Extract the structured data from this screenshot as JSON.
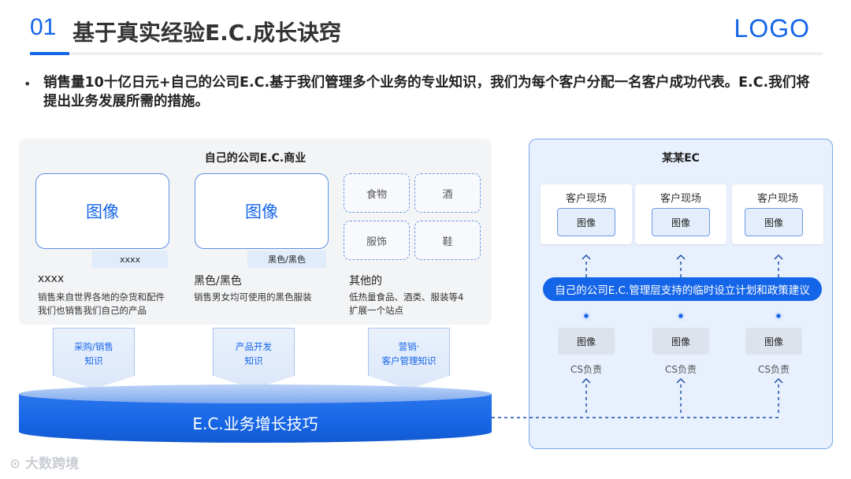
{
  "header": {
    "number": "01",
    "title": "基于真实经验E.C.成长诀窍",
    "logo": "LOGO"
  },
  "bullet": {
    "text": "销售量10十亿日元+自己的公司E.C.基于我们管理多个业务的专业知识，我们为每个客户分配一名客户成功代表。E.C.我们将提出业务发展所需的措施。"
  },
  "left_panel": {
    "title": "自己的公司E.C.商业",
    "columns": [
      {
        "image_label": "图像",
        "tag": "xxxx",
        "heading": "xxxx",
        "desc_lines": [
          "销售来自世界各地的杂货和配件",
          "我们也销售我们自己的产品"
        ]
      },
      {
        "image_label": "图像",
        "tag": "黑色/黑色",
        "heading": "黑色/黑色",
        "desc_lines": [
          "销售男女均可使用的黑色服装",
          ""
        ]
      },
      {
        "heading": "其他的",
        "desc_lines": [
          "低热量食品、酒类、服装等4",
          "扩展一个站点"
        ]
      }
    ],
    "categories": [
      "食物",
      "酒",
      "服饰",
      "鞋"
    ]
  },
  "knowledge": [
    {
      "line1": "采购/销售",
      "line2": "知识"
    },
    {
      "line1": "产品开发",
      "line2": "知识"
    },
    {
      "line1": "营销·",
      "line2": "客户管理知识"
    }
  ],
  "cylinder": {
    "label": "E.C.业务增长技巧"
  },
  "right_panel": {
    "title": "某某EC",
    "sites": [
      {
        "label": "客户现场",
        "image": "图像"
      },
      {
        "label": "客户现场",
        "image": "图像"
      },
      {
        "label": "客户现场",
        "image": "图像"
      }
    ],
    "management_bar": "自己的公司E.C.管理层支持的临时设立计划和政策建议",
    "cs": [
      {
        "image": "图像",
        "label": "CS负责"
      },
      {
        "image": "图像",
        "label": "CS负责"
      },
      {
        "image": "图像",
        "label": "CS负责"
      }
    ]
  },
  "watermark": "大数跨境",
  "colors": {
    "accent": "#1565e8",
    "panel_bg": "#f3f4f6",
    "right_bg": "#e8f0fd"
  }
}
